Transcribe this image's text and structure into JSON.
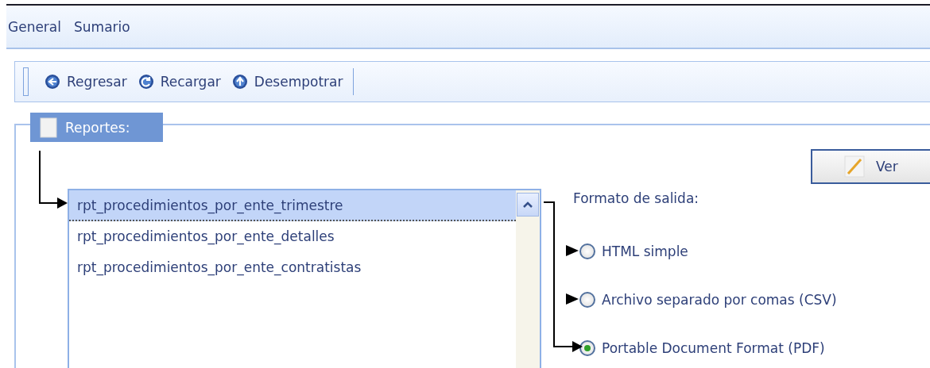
{
  "menu": [
    {
      "label": "General",
      "selected": false
    },
    {
      "label": "Sumario",
      "selected": false
    }
  ],
  "toolbar": [
    {
      "label": "Regresar",
      "kind": "back"
    },
    {
      "label": "Recargar",
      "kind": "reload"
    },
    {
      "label": "Desempotrar",
      "kind": "up"
    }
  ],
  "reports": {
    "legend": "Reportes:",
    "view_button": "Ver",
    "items": [
      {
        "label": "rpt_procedimientos_por_ente_trimestre",
        "selected": true
      },
      {
        "label": "rpt_procedimientos_por_ente_detalles",
        "selected": false
      },
      {
        "label": "rpt_procedimientos_por_ente_contratistas",
        "selected": false
      }
    ],
    "format_label": "Formato de salida:",
    "formats": [
      {
        "label": "HTML simple",
        "selected": false
      },
      {
        "label": "Archivo separado por comas (CSV)",
        "selected": false
      },
      {
        "label": "Portable Document Format (PDF)",
        "selected": true
      }
    ]
  }
}
